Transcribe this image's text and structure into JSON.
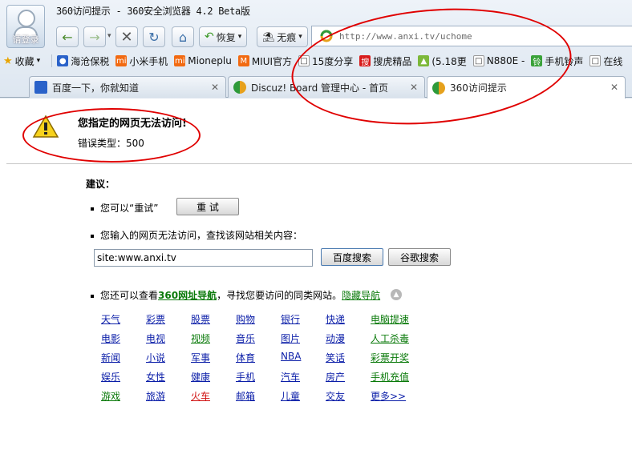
{
  "window": {
    "title": "360访问提示 - 360安全浏览器 4.2 Beta版",
    "login_label": "请登录"
  },
  "toolbar": {
    "restore_label": "恢复",
    "incognito_label": "无痕"
  },
  "address_bar": {
    "url": "http://www.anxi.tv/uchome"
  },
  "favorites": [
    {
      "label": "收藏",
      "icon": "star-icon"
    },
    {
      "label": "海沧保税",
      "icon": "paw-icon"
    },
    {
      "label": "小米手机",
      "icon": "mi-icon"
    },
    {
      "label": "Mioneplu",
      "icon": "mi-icon"
    },
    {
      "label": "MIUI官方",
      "icon": "m-icon"
    },
    {
      "label": "15度分享",
      "icon": "page-icon"
    },
    {
      "label": "搜虎精品",
      "icon": "sou-icon"
    },
    {
      "label": "(5.18更",
      "icon": "android-icon"
    },
    {
      "label": "N880E -",
      "icon": "page-icon"
    },
    {
      "label": "手机铃声",
      "icon": "ling-icon"
    },
    {
      "label": "在线",
      "icon": "page-icon"
    }
  ],
  "tabs": [
    {
      "label": "百度一下，你就知道"
    },
    {
      "label": "Discuz! Board 管理中心 - 首页"
    },
    {
      "label": "360访问提示"
    }
  ],
  "error": {
    "title": "您指定的网页无法访问!",
    "type_label": "错误类型：500"
  },
  "suggestions": {
    "heading": "建议：",
    "retry_text": "您可以“重试”",
    "retry_button": "重 试",
    "search_text": "您输入的网页无法访问，查找该网站相关内容：",
    "search_value": "site:www.anxi.tv",
    "baidu_button": "百度搜索",
    "google_button": "谷歌搜索",
    "nav_prefix": "您还可以查看",
    "nav_link": "360网址导航",
    "nav_suffix": "，寻找您要访问的同类网站。",
    "hide_link": "隐藏导航"
  },
  "nav_links": [
    [
      "天气",
      "彩票",
      "股票",
      "购物",
      "银行",
      "快递",
      "电脑提速"
    ],
    [
      "电影",
      "电视",
      "视频",
      "音乐",
      "图片",
      "动漫",
      "人工杀毒"
    ],
    [
      "新闻",
      "小说",
      "军事",
      "体育",
      "NBA",
      "笑话",
      "彩票开奖"
    ],
    [
      "娱乐",
      "女性",
      "健康",
      "手机",
      "汽车",
      "房产",
      "手机充值"
    ],
    [
      "游戏",
      "旅游",
      "火车",
      "邮箱",
      "儿童",
      "交友",
      "更多>>"
    ]
  ]
}
